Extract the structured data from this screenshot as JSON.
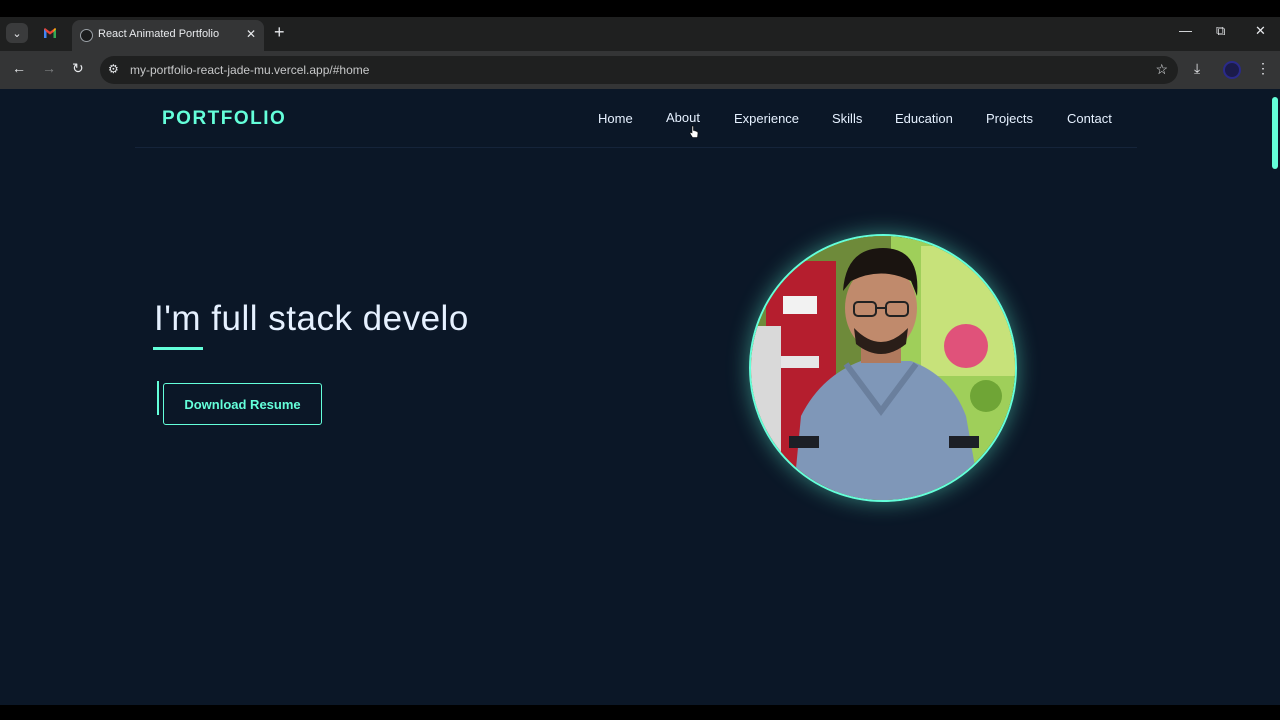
{
  "browser": {
    "tab_title": "React Animated Portfolio",
    "url": "my-portfolio-react-jade-mu.vercel.app/#home",
    "tab_search_icon": "chevron-down-icon",
    "new_tab_icon": "plus-icon"
  },
  "site": {
    "logo": "PORTFOLIO",
    "nav": [
      "Home",
      "About",
      "Experience",
      "Skills",
      "Education",
      "Projects",
      "Contact"
    ],
    "headline": "I'm full stack develo",
    "download_button": "Download Resume",
    "accent_color": "#64ffda",
    "background_color": "#0b1727",
    "text_color": "#e6f1ff"
  }
}
